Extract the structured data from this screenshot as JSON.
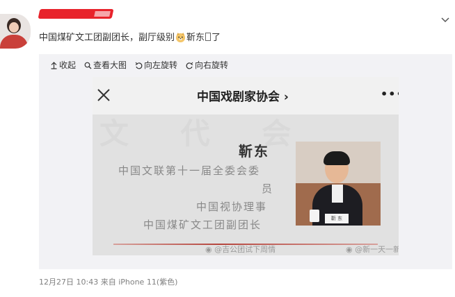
{
  "post": {
    "text_before_emoji": "中国煤矿文工团副团长，副厅级别",
    "text_after_emoji": "靳东",
    "text_end": "了",
    "timestamp": "12月27日 10:43",
    "source": "来自 iPhone 11(紫色)"
  },
  "toolbar": {
    "collapse": "收起",
    "view_large": "查看大图",
    "rotate_left": "向左旋转",
    "rotate_right": "向右旋转"
  },
  "photo": {
    "header_title": "中国戏剧家协会",
    "header_arrow": "›",
    "more": "•••",
    "person_name": "靳东",
    "role_line_1": "中国文联第十一届全委会委",
    "role_line_2": "员",
    "role_line_3": "中国视协理事",
    "role_line_4": "中国煤矿文工团副团长",
    "nameplate": "靳 东",
    "watermark_1": "@吉公团试下周情",
    "watermark_2": "@新一天一新",
    "background_watermark": "文 代 会"
  },
  "colors": {
    "username_redaction": "#e8232b",
    "panel_bg": "#f2f2f5",
    "timestamp": "#808080"
  },
  "icons": [
    "chevron-down-icon",
    "collapse-icon",
    "search-icon",
    "rotate-left-icon",
    "rotate-right-icon",
    "close-icon",
    "weibo-logo-icon"
  ]
}
